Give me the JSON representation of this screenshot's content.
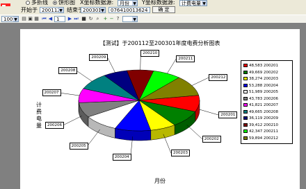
{
  "controls": {
    "chart_type_multi": "多折线",
    "chart_type_pie": "饼形图",
    "x_axis_label": "X坐标数据源:",
    "x_axis_value": "月份",
    "y_axis_label": "Y坐标数据源:",
    "y_axis_value": "计费电量",
    "start_label": "开始于",
    "start_value": "200112",
    "end_label": "结束于",
    "end_value": "200301",
    "code_value": "076410013624",
    "confirm_label": "确 定"
  },
  "toolbar": {
    "zoom": "100%",
    "page_value": "1"
  },
  "chart_data": {
    "type": "pie",
    "title": "【测试】于200112至200301年度电费分析图表",
    "xlabel": "月份",
    "ylabel": "计费电量",
    "categories": [
      "200201",
      "200202",
      "200203",
      "200204",
      "200205",
      "200206",
      "200207",
      "200208",
      "200209",
      "200210",
      "200211",
      "200212"
    ],
    "values": [
      48583,
      49669,
      38274,
      53288,
      51989,
      43783,
      41821,
      49665,
      36119,
      39412,
      42347,
      59894
    ],
    "legend_entries": [
      "48,583 200201",
      "49,669 200202",
      "38,274 200203",
      "53,288 200204",
      "51,989 200205",
      "43,783 200206",
      "41,821 200207",
      "49,665 200208",
      "36,119 200209",
      "39,412 200210",
      "42,347 200211",
      "59,894 200212"
    ],
    "colors": [
      "#ff0000",
      "#008000",
      "#ffff00",
      "#0000ff",
      "#ffffff",
      "#808080",
      "#ff00ff",
      "#008080",
      "#000080",
      "#800000",
      "#00ff00",
      "#808000"
    ],
    "legend_position": "right"
  }
}
